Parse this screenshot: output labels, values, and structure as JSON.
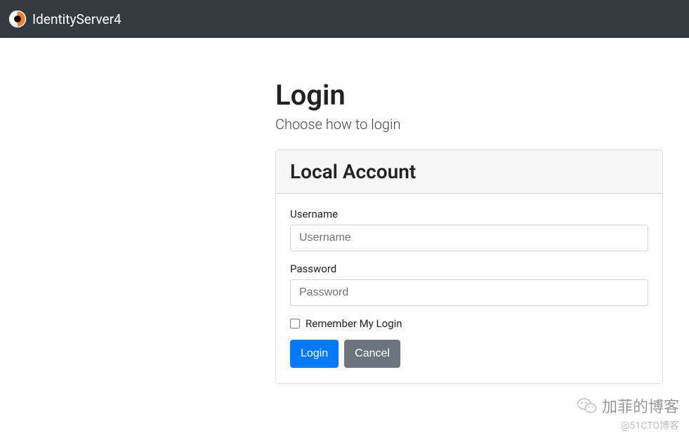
{
  "navbar": {
    "brand": "IdentityServer4"
  },
  "page": {
    "title": "Login",
    "subtitle": "Choose how to login"
  },
  "card": {
    "header": "Local Account"
  },
  "form": {
    "username_label": "Username",
    "username_placeholder": "Username",
    "username_value": "",
    "password_label": "Password",
    "password_placeholder": "Password",
    "password_value": "",
    "remember_label": "Remember My Login",
    "login_button": "Login",
    "cancel_button": "Cancel"
  },
  "watermark": {
    "main": "加菲的博客",
    "sub": "@51CTO博客"
  }
}
